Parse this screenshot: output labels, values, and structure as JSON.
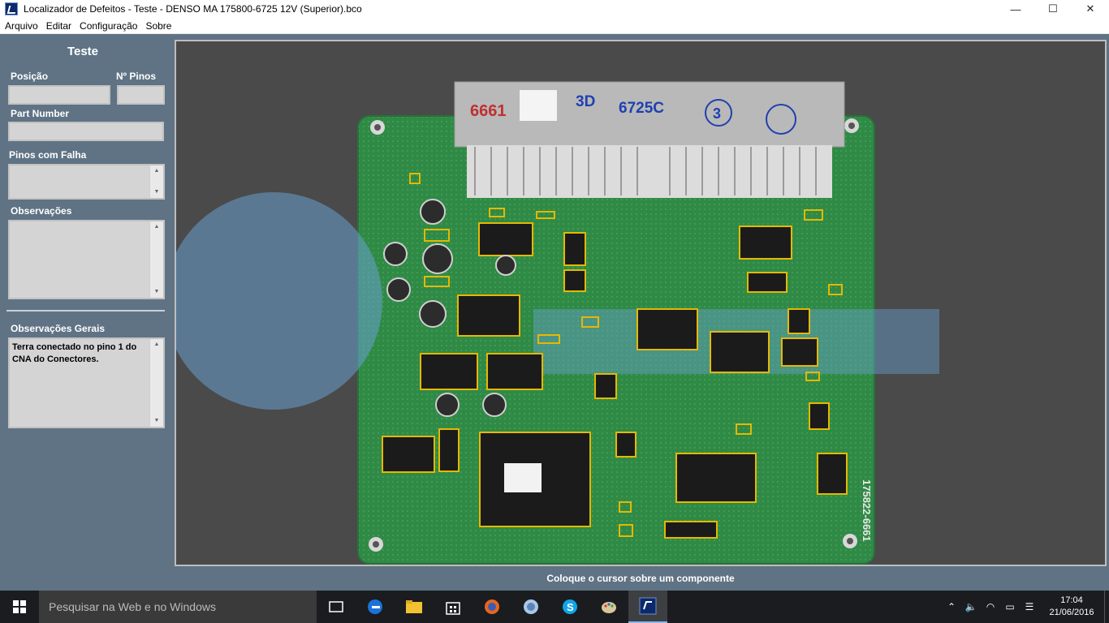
{
  "window": {
    "title": "Localizador de Defeitos - Teste - DENSO MA 175800-6725 12V (Superior).bco",
    "minimize": "—",
    "maximize": "☐",
    "close": "✕"
  },
  "menu": [
    "Arquivo",
    "Editar",
    "Configuração",
    "Sobre"
  ],
  "panel": {
    "title": "Teste",
    "posicao_label": "Posição",
    "pinos_label": "Nº Pinos",
    "part_number_label": "Part Number",
    "pinos_falha_label": "Pinos com Falha",
    "observacoes_label": "Observações",
    "observacoes_gerais_label": "Observações Gerais",
    "observacoes_gerais_value": "Terra conectado no pino 1 do CNA do Conectores."
  },
  "board": {
    "connector_marks": [
      "6661",
      "3D",
      "6725C",
      "3"
    ],
    "part_number_print": "175822-6661"
  },
  "status": "Coloque o cursor sobre um componente",
  "taskbar": {
    "search_placeholder": "Pesquisar na Web e no Windows",
    "time": "17:04",
    "date": "21/06/2016"
  },
  "colors": {
    "highlight": "#e6b800",
    "pcb": "#2f8a45",
    "panel": "#5f7385"
  }
}
